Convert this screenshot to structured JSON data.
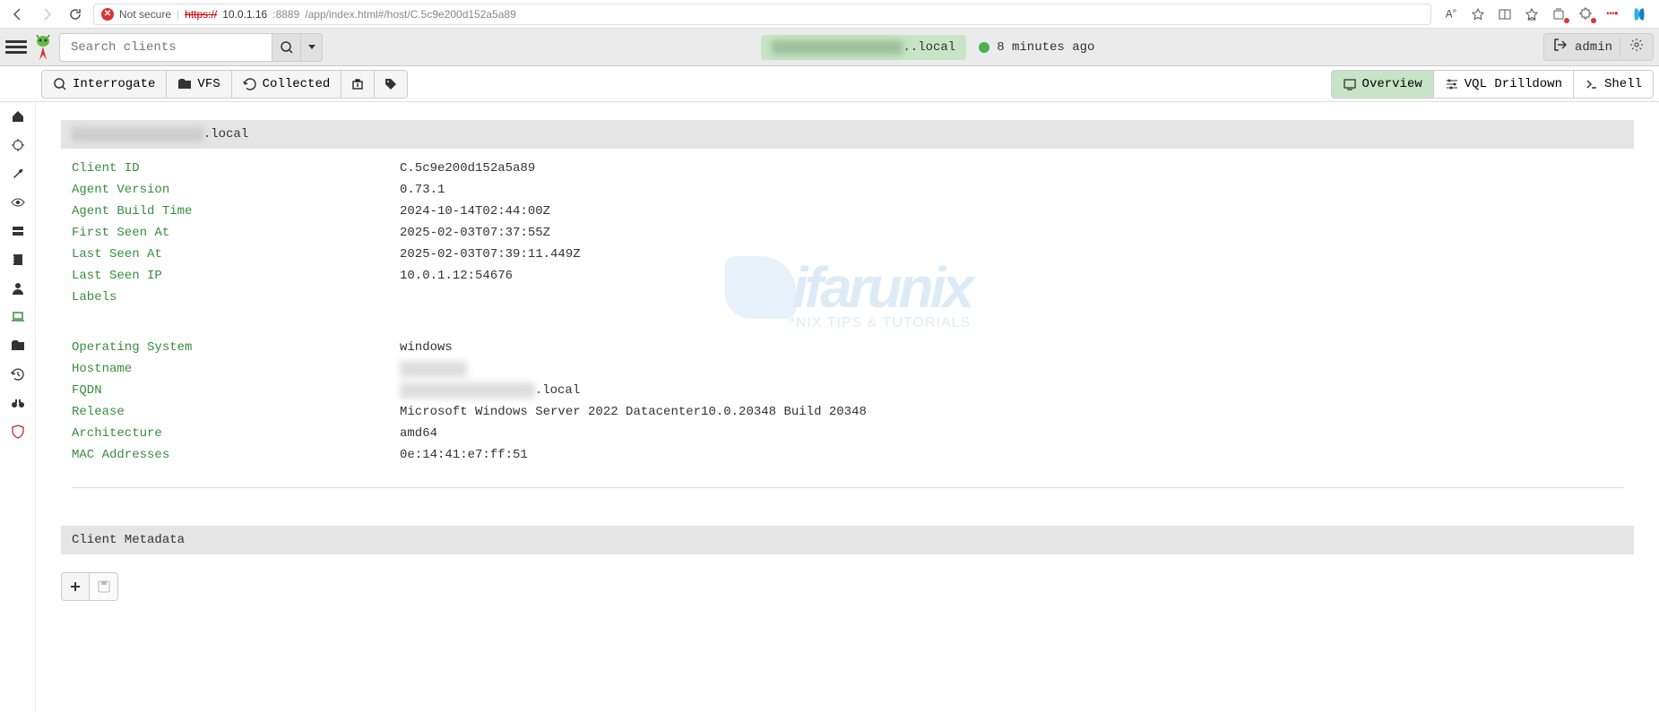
{
  "browser": {
    "insecure_label": "Not secure",
    "url_proto": "https://",
    "url_host": "10.0.1.16",
    "url_port": ":8889",
    "url_path": "/app/index.html#/host/C.5c9e200d152a5a89",
    "aa_icon": "A",
    "aa_icon2": "A"
  },
  "header": {
    "search_placeholder": "Search clients",
    "host_label_hidden": "REDACTED REDACTED",
    "host_label_suffix": "..local",
    "status_text": "8 minutes ago",
    "user": "admin"
  },
  "toolbar": {
    "interrogate": "Interrogate",
    "vfs": "VFS",
    "collected": "Collected"
  },
  "tabs": {
    "overview": "Overview",
    "vql": "VQL Drilldown",
    "shell": "Shell"
  },
  "host_panel": {
    "title_hidden": "REDACTED REDACTED",
    "title_suffix": ".local",
    "rows": {
      "client_id": {
        "label": "Client ID",
        "value": "C.5c9e200d152a5a89"
      },
      "agent_version": {
        "label": "Agent Version",
        "value": "0.73.1"
      },
      "agent_build_time": {
        "label": "Agent Build Time",
        "value": "2024-10-14T02:44:00Z"
      },
      "first_seen": {
        "label": "First Seen At",
        "value": "2025-02-03T07:37:55Z"
      },
      "last_seen": {
        "label": "Last Seen At",
        "value": "2025-02-03T07:39:11.449Z"
      },
      "last_seen_ip": {
        "label": "Last Seen IP",
        "value": "10.0.1.12:54676"
      },
      "labels": {
        "label": "Labels",
        "value": ""
      },
      "os": {
        "label": "Operating System",
        "value": "windows"
      },
      "hostname": {
        "label": "Hostname",
        "value_hidden": "REDACTED"
      },
      "fqdn": {
        "label": "FQDN",
        "value_hidden": "REDACTED REDACTED",
        "value_suffix": ".local"
      },
      "release": {
        "label": "Release",
        "value": "Microsoft Windows Server 2022 Datacenter10.0.20348 Build 20348"
      },
      "arch": {
        "label": "Architecture",
        "value": "amd64"
      },
      "mac": {
        "label": "MAC Addresses",
        "value": "0e:14:41:e7:ff:51"
      }
    }
  },
  "metadata_panel": {
    "title": "Client Metadata"
  },
  "watermark": {
    "main": "ifarunix",
    "sub": "*NIX TIPS & TUTORIALS"
  }
}
